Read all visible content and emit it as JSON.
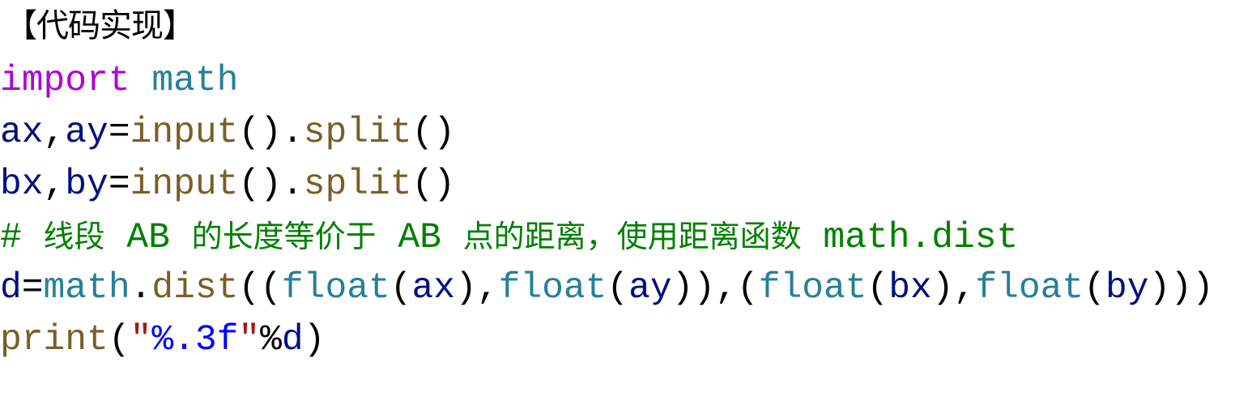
{
  "heading": "【代码实现】",
  "colors": {
    "keyword": "#af00db",
    "module": "#267f99",
    "variable": "#001080",
    "function": "#795e26",
    "punct": "#000000",
    "comment": "#008000",
    "string": "#a31515",
    "format": "#0000ff"
  },
  "code_lines": [
    [
      {
        "t": "import",
        "c": "keyword"
      },
      {
        "t": " ",
        "c": "punct"
      },
      {
        "t": "math",
        "c": "module"
      }
    ],
    [
      {
        "t": "ax",
        "c": "variable"
      },
      {
        "t": ",",
        "c": "punct"
      },
      {
        "t": "ay",
        "c": "variable"
      },
      {
        "t": "=",
        "c": "punct"
      },
      {
        "t": "input",
        "c": "function"
      },
      {
        "t": "().",
        "c": "punct"
      },
      {
        "t": "split",
        "c": "function"
      },
      {
        "t": "()",
        "c": "punct"
      }
    ],
    [
      {
        "t": "bx",
        "c": "variable"
      },
      {
        "t": ",",
        "c": "punct"
      },
      {
        "t": "by",
        "c": "variable"
      },
      {
        "t": "=",
        "c": "punct"
      },
      {
        "t": "input",
        "c": "function"
      },
      {
        "t": "().",
        "c": "punct"
      },
      {
        "t": "split",
        "c": "function"
      },
      {
        "t": "()",
        "c": "punct"
      }
    ],
    [
      {
        "t": "# ",
        "c": "comment"
      },
      {
        "t": "线段",
        "c": "comment",
        "cjk": true
      },
      {
        "t": " AB ",
        "c": "comment"
      },
      {
        "t": "的长度等价于",
        "c": "comment",
        "cjk": true
      },
      {
        "t": " AB ",
        "c": "comment"
      },
      {
        "t": "点的距离，使用距离函数",
        "c": "comment",
        "cjk": true
      },
      {
        "t": " math.dist",
        "c": "comment"
      }
    ],
    [
      {
        "t": "d",
        "c": "variable"
      },
      {
        "t": "=",
        "c": "punct"
      },
      {
        "t": "math",
        "c": "module"
      },
      {
        "t": ".",
        "c": "punct"
      },
      {
        "t": "dist",
        "c": "function"
      },
      {
        "t": "((",
        "c": "punct"
      },
      {
        "t": "float",
        "c": "module"
      },
      {
        "t": "(",
        "c": "punct"
      },
      {
        "t": "ax",
        "c": "variable"
      },
      {
        "t": "),",
        "c": "punct"
      },
      {
        "t": "float",
        "c": "module"
      },
      {
        "t": "(",
        "c": "punct"
      },
      {
        "t": "ay",
        "c": "variable"
      },
      {
        "t": ")),(",
        "c": "punct"
      },
      {
        "t": "float",
        "c": "module"
      },
      {
        "t": "(",
        "c": "punct"
      },
      {
        "t": "bx",
        "c": "variable"
      },
      {
        "t": "),",
        "c": "punct"
      },
      {
        "t": "float",
        "c": "module"
      },
      {
        "t": "(",
        "c": "punct"
      },
      {
        "t": "by",
        "c": "variable"
      },
      {
        "t": ")))",
        "c": "punct"
      }
    ],
    [
      {
        "t": "print",
        "c": "function"
      },
      {
        "t": "(",
        "c": "punct"
      },
      {
        "t": "\"",
        "c": "string"
      },
      {
        "t": "%.3f",
        "c": "format"
      },
      {
        "t": "\"",
        "c": "string"
      },
      {
        "t": "%",
        "c": "punct"
      },
      {
        "t": "d",
        "c": "variable"
      },
      {
        "t": ")",
        "c": "punct"
      }
    ]
  ]
}
